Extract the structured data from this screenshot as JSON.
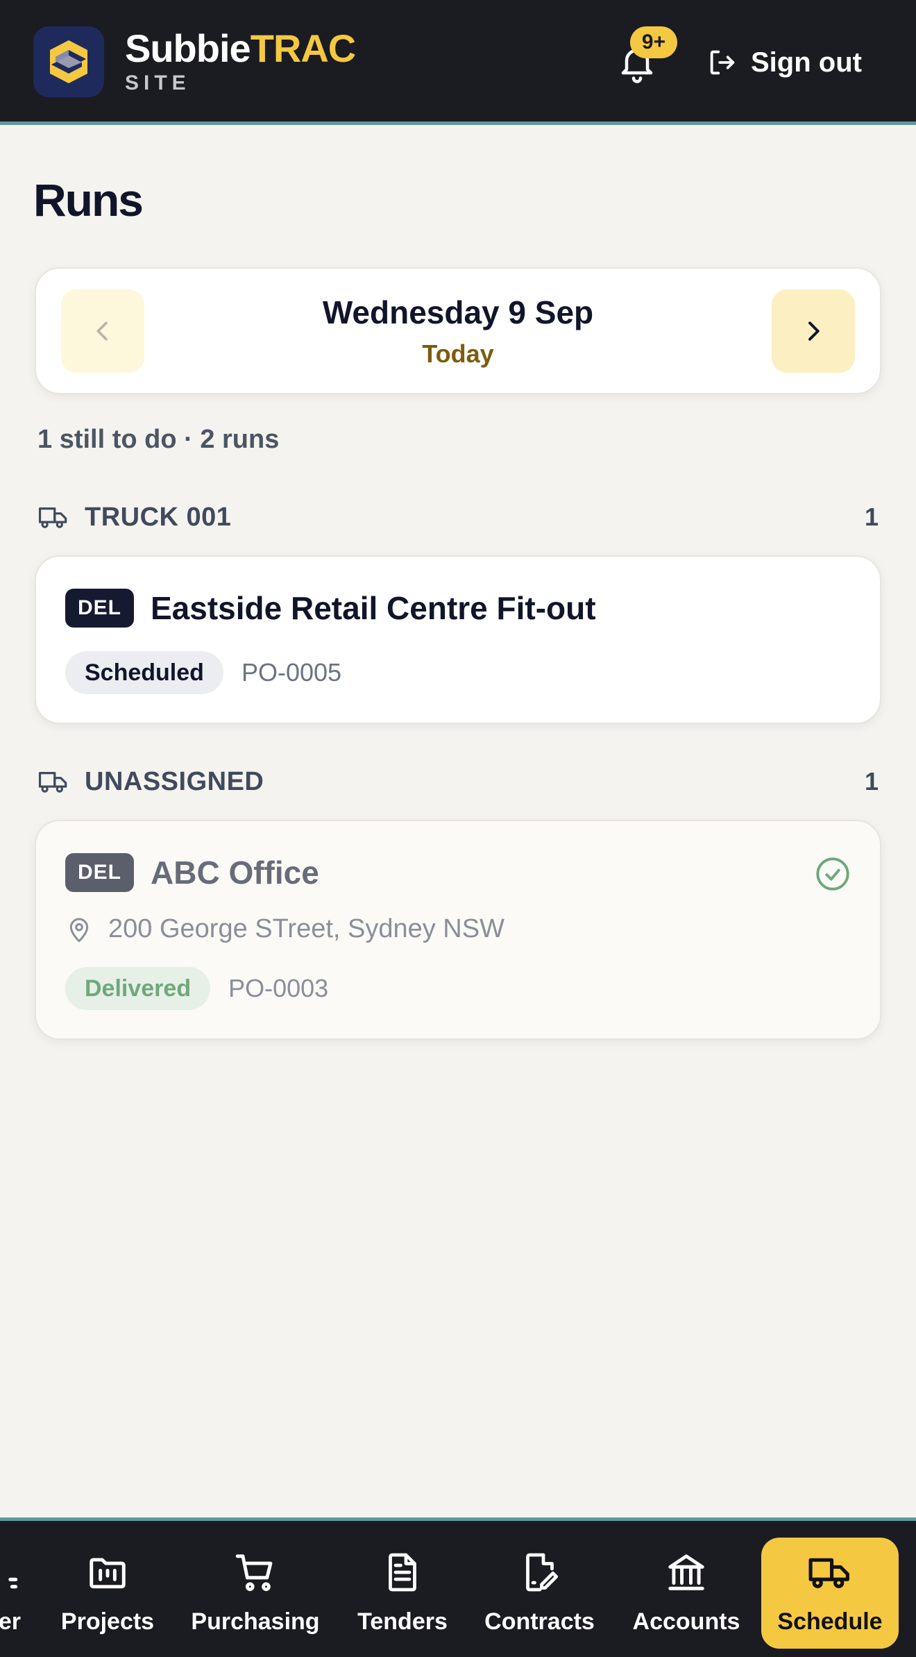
{
  "header": {
    "brand_part1": "Subbie",
    "brand_part2": "TRAC",
    "brand_sub": "SITE",
    "notification_badge": "9+",
    "sign_out_label": "Sign out"
  },
  "page": {
    "title": "Runs"
  },
  "date_nav": {
    "date": "Wednesday 9 Sep",
    "relative": "Today",
    "prev_icon": "chevron-left-icon",
    "next_icon": "chevron-right-icon"
  },
  "summary": "1 still to do · 2 runs",
  "groups": [
    {
      "title": "TRUCK 001",
      "count": "1",
      "runs": [
        {
          "tag": "DEL",
          "name": "Eastside Retail Centre Fit-out",
          "status": "Scheduled",
          "po": "PO-0005"
        }
      ]
    },
    {
      "title": "UNASSIGNED",
      "count": "1",
      "runs": [
        {
          "tag": "DEL",
          "name": "ABC Office",
          "address": "200 George STreet, Sydney NSW",
          "status": "Delivered",
          "po": "PO-0003",
          "completed": true
        }
      ]
    }
  ],
  "bottom_nav": {
    "items": [
      {
        "label": "er",
        "icon": "partial-icon"
      },
      {
        "label": "Projects",
        "icon": "folder-icon"
      },
      {
        "label": "Purchasing",
        "icon": "cart-icon"
      },
      {
        "label": "Tenders",
        "icon": "document-icon"
      },
      {
        "label": "Contracts",
        "icon": "contract-edit-icon"
      },
      {
        "label": "Accounts",
        "icon": "bank-icon"
      },
      {
        "label": "Schedule",
        "icon": "truck-icon",
        "active": true
      }
    ]
  },
  "colors": {
    "brand_yellow": "#f5c842",
    "header_bg": "#1b1b22",
    "accent_teal": "#5f9a9a",
    "delivered_green": "#6fa87b"
  }
}
